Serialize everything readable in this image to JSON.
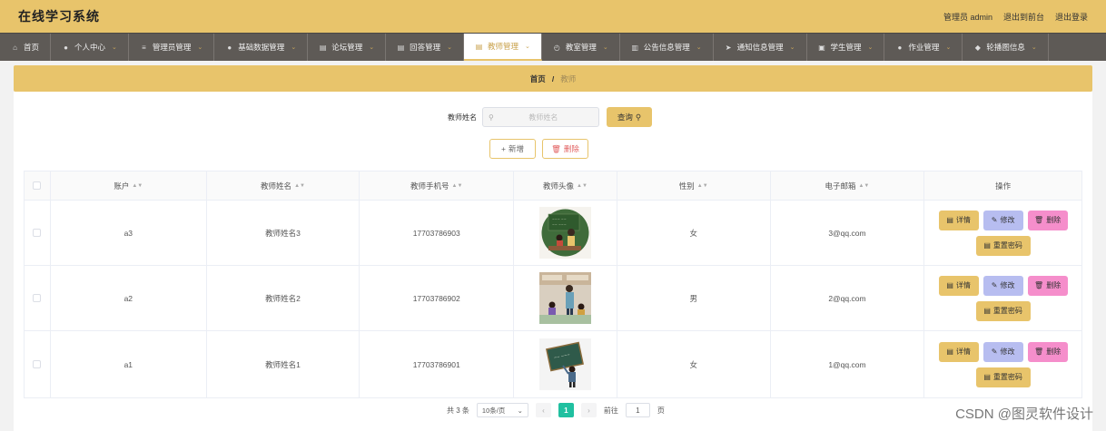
{
  "header": {
    "title": "在线学习系统",
    "admin_label": "管理员 admin",
    "front_link": "退出到前台",
    "logout_link": "退出登录"
  },
  "nav": [
    {
      "label": "首页",
      "icon": "home-icon",
      "chev": false
    },
    {
      "label": "个人中心",
      "icon": "user-icon",
      "chev": true
    },
    {
      "label": "管理员管理",
      "icon": "list-icon",
      "chev": true
    },
    {
      "label": "基础数据管理",
      "icon": "user-icon",
      "chev": true
    },
    {
      "label": "论坛管理",
      "icon": "document-icon",
      "chev": true
    },
    {
      "label": "回答管理",
      "icon": "document-icon",
      "chev": true
    },
    {
      "label": "教师管理",
      "icon": "document-icon",
      "chev": true,
      "active": true
    },
    {
      "label": "教室管理",
      "icon": "clock-icon",
      "chev": true
    },
    {
      "label": "公告信息管理",
      "icon": "chart-icon",
      "chev": true
    },
    {
      "label": "通知信息管理",
      "icon": "send-icon",
      "chev": true
    },
    {
      "label": "学生管理",
      "icon": "printer-icon",
      "chev": true
    },
    {
      "label": "作业管理",
      "icon": "user-icon",
      "chev": true
    },
    {
      "label": "轮播图信息",
      "icon": "location-icon",
      "chev": true
    }
  ],
  "breadcrumb": {
    "home": "首页",
    "separator": "/",
    "current": "教师"
  },
  "search": {
    "label": "教师姓名",
    "placeholder": "教师姓名",
    "button": "查询"
  },
  "actions": {
    "add": "新增",
    "delete": "删除"
  },
  "table": {
    "columns": [
      "账户",
      "教师姓名",
      "教师手机号",
      "教师头像",
      "性别",
      "电子邮箱",
      "操作"
    ],
    "rows": [
      {
        "account": "a3",
        "name": "教师姓名3",
        "phone": "17703786903",
        "gender": "女",
        "email": "3@qq.com"
      },
      {
        "account": "a2",
        "name": "教师姓名2",
        "phone": "17703786902",
        "gender": "男",
        "email": "2@qq.com"
      },
      {
        "account": "a1",
        "name": "教师姓名1",
        "phone": "17703786901",
        "gender": "女",
        "email": "1@qq.com"
      }
    ],
    "ops": {
      "detail": "详情",
      "edit": "修改",
      "delete": "删除",
      "reset": "重置密码"
    }
  },
  "pagination": {
    "total": "共 3 条",
    "page_size": "10条/页",
    "current_page": "1",
    "goto_label": "前往",
    "goto_value": "1",
    "page_unit": "页"
  },
  "watermark": "CSDN @图灵软件设计",
  "colors": {
    "accent": "#e8c46b",
    "nav_bg": "#5e5a56",
    "edit": "#b7bdf0",
    "delete": "#f58ecb",
    "page_active": "#20c0a0"
  }
}
